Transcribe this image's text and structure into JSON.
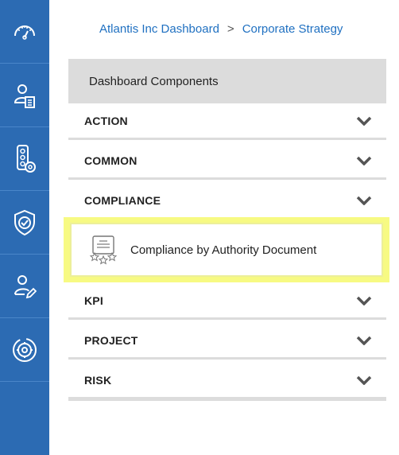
{
  "breadcrumb": {
    "root": "Atlantis Inc Dashboard",
    "separator": ">",
    "current": "Corporate Strategy"
  },
  "rail": {
    "items": [
      {
        "icon": "dashboard-gauge-icon"
      },
      {
        "icon": "user-document-icon"
      },
      {
        "icon": "traffic-light-settings-icon"
      },
      {
        "icon": "shield-check-icon"
      },
      {
        "icon": "user-edit-icon"
      },
      {
        "icon": "gear-icon"
      }
    ]
  },
  "panel": {
    "header": "Dashboard Components",
    "sections": [
      {
        "label": "ACTION"
      },
      {
        "label": "COMMON"
      },
      {
        "label": "COMPLIANCE"
      },
      {
        "label": "KPI"
      },
      {
        "label": "PROJECT"
      },
      {
        "label": "RISK"
      }
    ],
    "component": {
      "label": "Compliance by Authority Document",
      "icon": "certificate-stars-icon"
    }
  },
  "colors": {
    "rail": "#2c6bb3",
    "link": "#1f70c1",
    "highlight": "#f7fa83",
    "header": "#dcdcdc"
  }
}
